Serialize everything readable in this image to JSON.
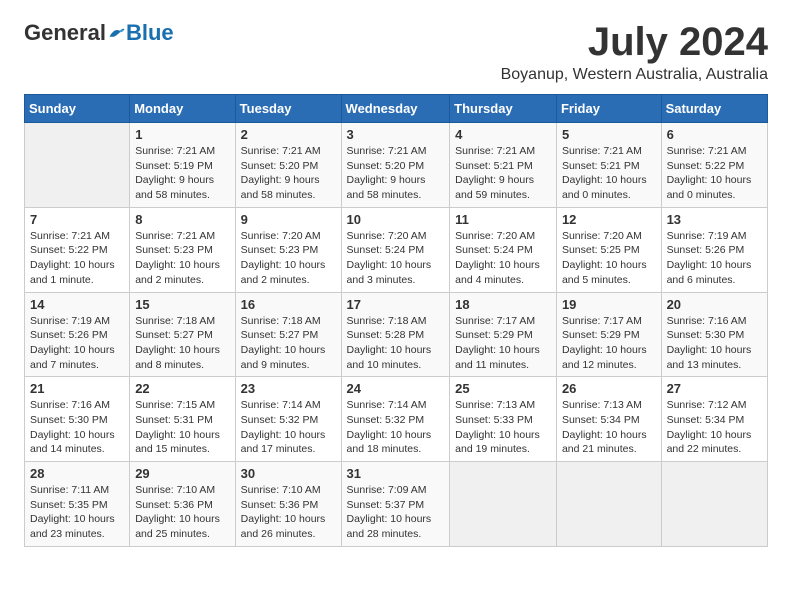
{
  "header": {
    "logo_general": "General",
    "logo_blue": "Blue",
    "month_year": "July 2024",
    "location": "Boyanup, Western Australia, Australia"
  },
  "weekdays": [
    "Sunday",
    "Monday",
    "Tuesday",
    "Wednesday",
    "Thursday",
    "Friday",
    "Saturday"
  ],
  "weeks": [
    [
      {
        "day": "",
        "sunrise": "",
        "sunset": "",
        "daylight": ""
      },
      {
        "day": "1",
        "sunrise": "Sunrise: 7:21 AM",
        "sunset": "Sunset: 5:19 PM",
        "daylight": "Daylight: 9 hours and 58 minutes."
      },
      {
        "day": "2",
        "sunrise": "Sunrise: 7:21 AM",
        "sunset": "Sunset: 5:20 PM",
        "daylight": "Daylight: 9 hours and 58 minutes."
      },
      {
        "day": "3",
        "sunrise": "Sunrise: 7:21 AM",
        "sunset": "Sunset: 5:20 PM",
        "daylight": "Daylight: 9 hours and 58 minutes."
      },
      {
        "day": "4",
        "sunrise": "Sunrise: 7:21 AM",
        "sunset": "Sunset: 5:21 PM",
        "daylight": "Daylight: 9 hours and 59 minutes."
      },
      {
        "day": "5",
        "sunrise": "Sunrise: 7:21 AM",
        "sunset": "Sunset: 5:21 PM",
        "daylight": "Daylight: 10 hours and 0 minutes."
      },
      {
        "day": "6",
        "sunrise": "Sunrise: 7:21 AM",
        "sunset": "Sunset: 5:22 PM",
        "daylight": "Daylight: 10 hours and 0 minutes."
      }
    ],
    [
      {
        "day": "7",
        "sunrise": "Sunrise: 7:21 AM",
        "sunset": "Sunset: 5:22 PM",
        "daylight": "Daylight: 10 hours and 1 minute."
      },
      {
        "day": "8",
        "sunrise": "Sunrise: 7:21 AM",
        "sunset": "Sunset: 5:23 PM",
        "daylight": "Daylight: 10 hours and 2 minutes."
      },
      {
        "day": "9",
        "sunrise": "Sunrise: 7:20 AM",
        "sunset": "Sunset: 5:23 PM",
        "daylight": "Daylight: 10 hours and 2 minutes."
      },
      {
        "day": "10",
        "sunrise": "Sunrise: 7:20 AM",
        "sunset": "Sunset: 5:24 PM",
        "daylight": "Daylight: 10 hours and 3 minutes."
      },
      {
        "day": "11",
        "sunrise": "Sunrise: 7:20 AM",
        "sunset": "Sunset: 5:24 PM",
        "daylight": "Daylight: 10 hours and 4 minutes."
      },
      {
        "day": "12",
        "sunrise": "Sunrise: 7:20 AM",
        "sunset": "Sunset: 5:25 PM",
        "daylight": "Daylight: 10 hours and 5 minutes."
      },
      {
        "day": "13",
        "sunrise": "Sunrise: 7:19 AM",
        "sunset": "Sunset: 5:26 PM",
        "daylight": "Daylight: 10 hours and 6 minutes."
      }
    ],
    [
      {
        "day": "14",
        "sunrise": "Sunrise: 7:19 AM",
        "sunset": "Sunset: 5:26 PM",
        "daylight": "Daylight: 10 hours and 7 minutes."
      },
      {
        "day": "15",
        "sunrise": "Sunrise: 7:18 AM",
        "sunset": "Sunset: 5:27 PM",
        "daylight": "Daylight: 10 hours and 8 minutes."
      },
      {
        "day": "16",
        "sunrise": "Sunrise: 7:18 AM",
        "sunset": "Sunset: 5:27 PM",
        "daylight": "Daylight: 10 hours and 9 minutes."
      },
      {
        "day": "17",
        "sunrise": "Sunrise: 7:18 AM",
        "sunset": "Sunset: 5:28 PM",
        "daylight": "Daylight: 10 hours and 10 minutes."
      },
      {
        "day": "18",
        "sunrise": "Sunrise: 7:17 AM",
        "sunset": "Sunset: 5:29 PM",
        "daylight": "Daylight: 10 hours and 11 minutes."
      },
      {
        "day": "19",
        "sunrise": "Sunrise: 7:17 AM",
        "sunset": "Sunset: 5:29 PM",
        "daylight": "Daylight: 10 hours and 12 minutes."
      },
      {
        "day": "20",
        "sunrise": "Sunrise: 7:16 AM",
        "sunset": "Sunset: 5:30 PM",
        "daylight": "Daylight: 10 hours and 13 minutes."
      }
    ],
    [
      {
        "day": "21",
        "sunrise": "Sunrise: 7:16 AM",
        "sunset": "Sunset: 5:30 PM",
        "daylight": "Daylight: 10 hours and 14 minutes."
      },
      {
        "day": "22",
        "sunrise": "Sunrise: 7:15 AM",
        "sunset": "Sunset: 5:31 PM",
        "daylight": "Daylight: 10 hours and 15 minutes."
      },
      {
        "day": "23",
        "sunrise": "Sunrise: 7:14 AM",
        "sunset": "Sunset: 5:32 PM",
        "daylight": "Daylight: 10 hours and 17 minutes."
      },
      {
        "day": "24",
        "sunrise": "Sunrise: 7:14 AM",
        "sunset": "Sunset: 5:32 PM",
        "daylight": "Daylight: 10 hours and 18 minutes."
      },
      {
        "day": "25",
        "sunrise": "Sunrise: 7:13 AM",
        "sunset": "Sunset: 5:33 PM",
        "daylight": "Daylight: 10 hours and 19 minutes."
      },
      {
        "day": "26",
        "sunrise": "Sunrise: 7:13 AM",
        "sunset": "Sunset: 5:34 PM",
        "daylight": "Daylight: 10 hours and 21 minutes."
      },
      {
        "day": "27",
        "sunrise": "Sunrise: 7:12 AM",
        "sunset": "Sunset: 5:34 PM",
        "daylight": "Daylight: 10 hours and 22 minutes."
      }
    ],
    [
      {
        "day": "28",
        "sunrise": "Sunrise: 7:11 AM",
        "sunset": "Sunset: 5:35 PM",
        "daylight": "Daylight: 10 hours and 23 minutes."
      },
      {
        "day": "29",
        "sunrise": "Sunrise: 7:10 AM",
        "sunset": "Sunset: 5:36 PM",
        "daylight": "Daylight: 10 hours and 25 minutes."
      },
      {
        "day": "30",
        "sunrise": "Sunrise: 7:10 AM",
        "sunset": "Sunset: 5:36 PM",
        "daylight": "Daylight: 10 hours and 26 minutes."
      },
      {
        "day": "31",
        "sunrise": "Sunrise: 7:09 AM",
        "sunset": "Sunset: 5:37 PM",
        "daylight": "Daylight: 10 hours and 28 minutes."
      },
      {
        "day": "",
        "sunrise": "",
        "sunset": "",
        "daylight": ""
      },
      {
        "day": "",
        "sunrise": "",
        "sunset": "",
        "daylight": ""
      },
      {
        "day": "",
        "sunrise": "",
        "sunset": "",
        "daylight": ""
      }
    ]
  ]
}
